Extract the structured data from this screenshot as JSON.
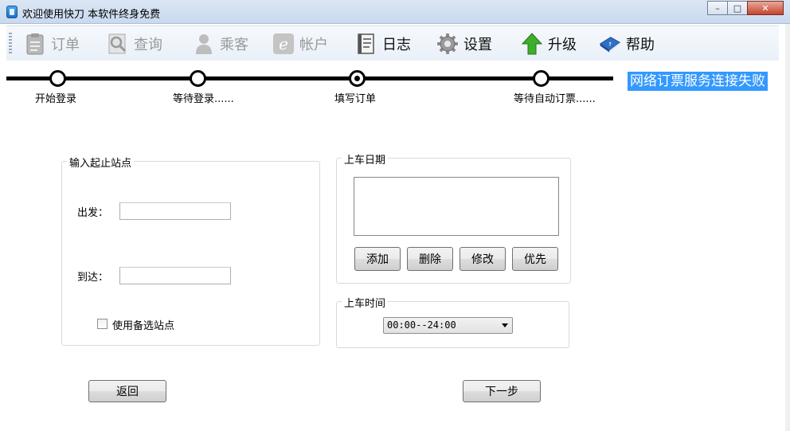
{
  "window": {
    "title": "欢迎使用快刀 本软件终身免费",
    "minimize": "–",
    "maximize": "□",
    "close": "✕"
  },
  "toolbar": {
    "items": [
      {
        "label": "订单",
        "icon": "clipboard-icon",
        "enabled": false
      },
      {
        "label": "查询",
        "icon": "magnifier-icon",
        "enabled": false
      },
      {
        "label": "乘客",
        "icon": "person-icon",
        "enabled": false
      },
      {
        "label": "帐户",
        "icon": "ie-icon",
        "enabled": false
      },
      {
        "label": "日志",
        "icon": "log-book-icon",
        "enabled": true
      },
      {
        "label": "设置",
        "icon": "gear-icon",
        "enabled": true
      },
      {
        "label": "升级",
        "icon": "up-arrow-icon",
        "enabled": true
      },
      {
        "label": "帮助",
        "icon": "help-book-icon",
        "enabled": true
      }
    ]
  },
  "progress": {
    "steps": [
      {
        "label": "开始登录",
        "active": false
      },
      {
        "label": "等待登录......",
        "active": false
      },
      {
        "label": "填写订单",
        "active": true
      },
      {
        "label": "等待自动订票......",
        "active": false
      }
    ],
    "status": "网络订票服务连接失败"
  },
  "stations": {
    "group_title": "输入起止站点",
    "from_label": "出发：",
    "from_value": "",
    "to_label": "到达：",
    "to_value": "",
    "alt_station_label": "使用备选站点",
    "alt_station_checked": false
  },
  "date": {
    "group_title": "上车日期",
    "dates": [],
    "add": "添加",
    "delete": "删除",
    "edit": "修改",
    "priority": "优先"
  },
  "time": {
    "group_title": "上车时间",
    "selected": "00:00--24:00"
  },
  "nav": {
    "back": "返回",
    "next": "下一步"
  },
  "colors": {
    "status_bg": "#3399ff",
    "title_bar": "#c9d9ee"
  }
}
